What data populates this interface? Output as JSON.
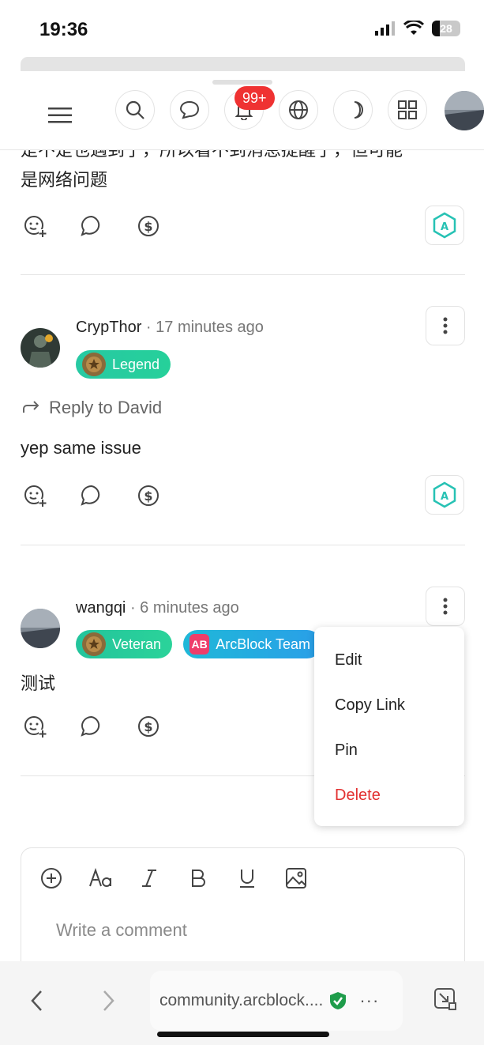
{
  "status_bar": {
    "time": "19:36",
    "battery": "28"
  },
  "header": {
    "notification_count": "99+"
  },
  "feed": {
    "partial_text_line1": "是不是也遇到了，所以看不到消息提醒了，但可能",
    "partial_text_line2": "是网络问题",
    "posts": [
      {
        "author": "CrypThor",
        "time": "· 17 minutes ago",
        "badges": [
          "Legend"
        ],
        "reply_to": "Reply to David",
        "body": "yep same issue"
      },
      {
        "author": "wangqi",
        "time": "· 6 minutes ago",
        "badges": [
          "Veteran",
          "ArcBlock Team"
        ],
        "badge_logo": "AB",
        "body": "测试"
      }
    ]
  },
  "menu": {
    "items": [
      "Edit",
      "Copy Link",
      "Pin",
      "Delete"
    ]
  },
  "composer": {
    "placeholder": "Write a comment"
  },
  "browser": {
    "url": "community.arcblock...."
  },
  "colors": {
    "accent": "#2bc7a0",
    "danger": "#e23030",
    "notification": "#ef3232"
  },
  "icons": [
    "menu-icon",
    "search-icon",
    "chat-icon",
    "bell-icon",
    "globe-icon",
    "moon-icon",
    "grid-icon",
    "reaction-add-icon",
    "comment-icon",
    "dollar-icon",
    "token-hexagon-icon",
    "more-vertical-icon",
    "reply-arrow-icon",
    "plus-circle-icon",
    "font-size-icon",
    "italic-icon",
    "bold-icon",
    "underline-icon",
    "image-icon",
    "chevron-left-icon",
    "chevron-right-icon",
    "shield-check-icon",
    "shrink-icon"
  ]
}
